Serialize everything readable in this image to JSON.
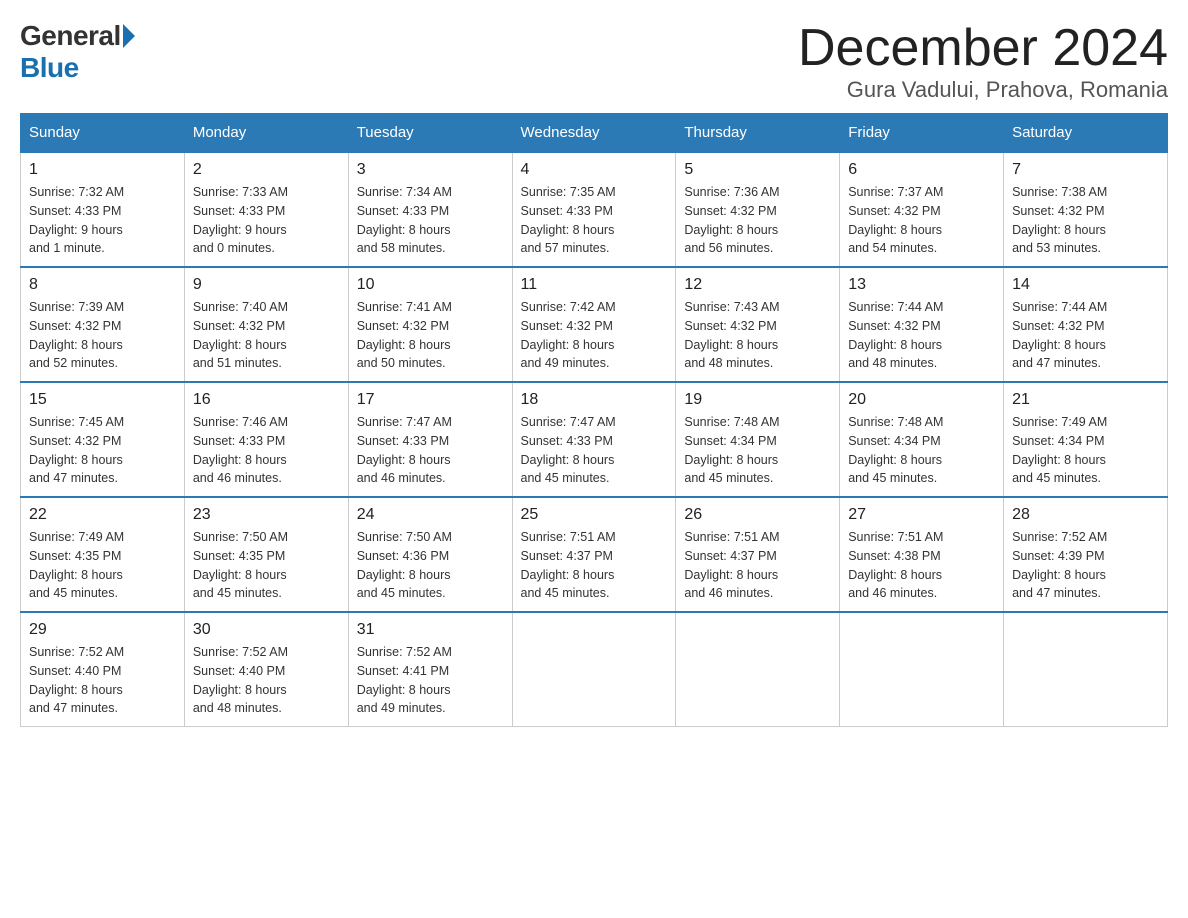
{
  "header": {
    "logo_general": "General",
    "logo_blue": "Blue",
    "title": "December 2024",
    "subtitle": "Gura Vadului, Prahova, Romania"
  },
  "calendar": {
    "days_of_week": [
      "Sunday",
      "Monday",
      "Tuesday",
      "Wednesday",
      "Thursday",
      "Friday",
      "Saturday"
    ],
    "weeks": [
      [
        {
          "day": "1",
          "sunrise": "7:32 AM",
          "sunset": "4:33 PM",
          "daylight": "9 hours and 1 minute."
        },
        {
          "day": "2",
          "sunrise": "7:33 AM",
          "sunset": "4:33 PM",
          "daylight": "9 hours and 0 minutes."
        },
        {
          "day": "3",
          "sunrise": "7:34 AM",
          "sunset": "4:33 PM",
          "daylight": "8 hours and 58 minutes."
        },
        {
          "day": "4",
          "sunrise": "7:35 AM",
          "sunset": "4:33 PM",
          "daylight": "8 hours and 57 minutes."
        },
        {
          "day": "5",
          "sunrise": "7:36 AM",
          "sunset": "4:32 PM",
          "daylight": "8 hours and 56 minutes."
        },
        {
          "day": "6",
          "sunrise": "7:37 AM",
          "sunset": "4:32 PM",
          "daylight": "8 hours and 54 minutes."
        },
        {
          "day": "7",
          "sunrise": "7:38 AM",
          "sunset": "4:32 PM",
          "daylight": "8 hours and 53 minutes."
        }
      ],
      [
        {
          "day": "8",
          "sunrise": "7:39 AM",
          "sunset": "4:32 PM",
          "daylight": "8 hours and 52 minutes."
        },
        {
          "day": "9",
          "sunrise": "7:40 AM",
          "sunset": "4:32 PM",
          "daylight": "8 hours and 51 minutes."
        },
        {
          "day": "10",
          "sunrise": "7:41 AM",
          "sunset": "4:32 PM",
          "daylight": "8 hours and 50 minutes."
        },
        {
          "day": "11",
          "sunrise": "7:42 AM",
          "sunset": "4:32 PM",
          "daylight": "8 hours and 49 minutes."
        },
        {
          "day": "12",
          "sunrise": "7:43 AM",
          "sunset": "4:32 PM",
          "daylight": "8 hours and 48 minutes."
        },
        {
          "day": "13",
          "sunrise": "7:44 AM",
          "sunset": "4:32 PM",
          "daylight": "8 hours and 48 minutes."
        },
        {
          "day": "14",
          "sunrise": "7:44 AM",
          "sunset": "4:32 PM",
          "daylight": "8 hours and 47 minutes."
        }
      ],
      [
        {
          "day": "15",
          "sunrise": "7:45 AM",
          "sunset": "4:32 PM",
          "daylight": "8 hours and 47 minutes."
        },
        {
          "day": "16",
          "sunrise": "7:46 AM",
          "sunset": "4:33 PM",
          "daylight": "8 hours and 46 minutes."
        },
        {
          "day": "17",
          "sunrise": "7:47 AM",
          "sunset": "4:33 PM",
          "daylight": "8 hours and 46 minutes."
        },
        {
          "day": "18",
          "sunrise": "7:47 AM",
          "sunset": "4:33 PM",
          "daylight": "8 hours and 45 minutes."
        },
        {
          "day": "19",
          "sunrise": "7:48 AM",
          "sunset": "4:34 PM",
          "daylight": "8 hours and 45 minutes."
        },
        {
          "day": "20",
          "sunrise": "7:48 AM",
          "sunset": "4:34 PM",
          "daylight": "8 hours and 45 minutes."
        },
        {
          "day": "21",
          "sunrise": "7:49 AM",
          "sunset": "4:34 PM",
          "daylight": "8 hours and 45 minutes."
        }
      ],
      [
        {
          "day": "22",
          "sunrise": "7:49 AM",
          "sunset": "4:35 PM",
          "daylight": "8 hours and 45 minutes."
        },
        {
          "day": "23",
          "sunrise": "7:50 AM",
          "sunset": "4:35 PM",
          "daylight": "8 hours and 45 minutes."
        },
        {
          "day": "24",
          "sunrise": "7:50 AM",
          "sunset": "4:36 PM",
          "daylight": "8 hours and 45 minutes."
        },
        {
          "day": "25",
          "sunrise": "7:51 AM",
          "sunset": "4:37 PM",
          "daylight": "8 hours and 45 minutes."
        },
        {
          "day": "26",
          "sunrise": "7:51 AM",
          "sunset": "4:37 PM",
          "daylight": "8 hours and 46 minutes."
        },
        {
          "day": "27",
          "sunrise": "7:51 AM",
          "sunset": "4:38 PM",
          "daylight": "8 hours and 46 minutes."
        },
        {
          "day": "28",
          "sunrise": "7:52 AM",
          "sunset": "4:39 PM",
          "daylight": "8 hours and 47 minutes."
        }
      ],
      [
        {
          "day": "29",
          "sunrise": "7:52 AM",
          "sunset": "4:40 PM",
          "daylight": "8 hours and 47 minutes."
        },
        {
          "day": "30",
          "sunrise": "7:52 AM",
          "sunset": "4:40 PM",
          "daylight": "8 hours and 48 minutes."
        },
        {
          "day": "31",
          "sunrise": "7:52 AM",
          "sunset": "4:41 PM",
          "daylight": "8 hours and 49 minutes."
        },
        null,
        null,
        null,
        null
      ]
    ]
  }
}
